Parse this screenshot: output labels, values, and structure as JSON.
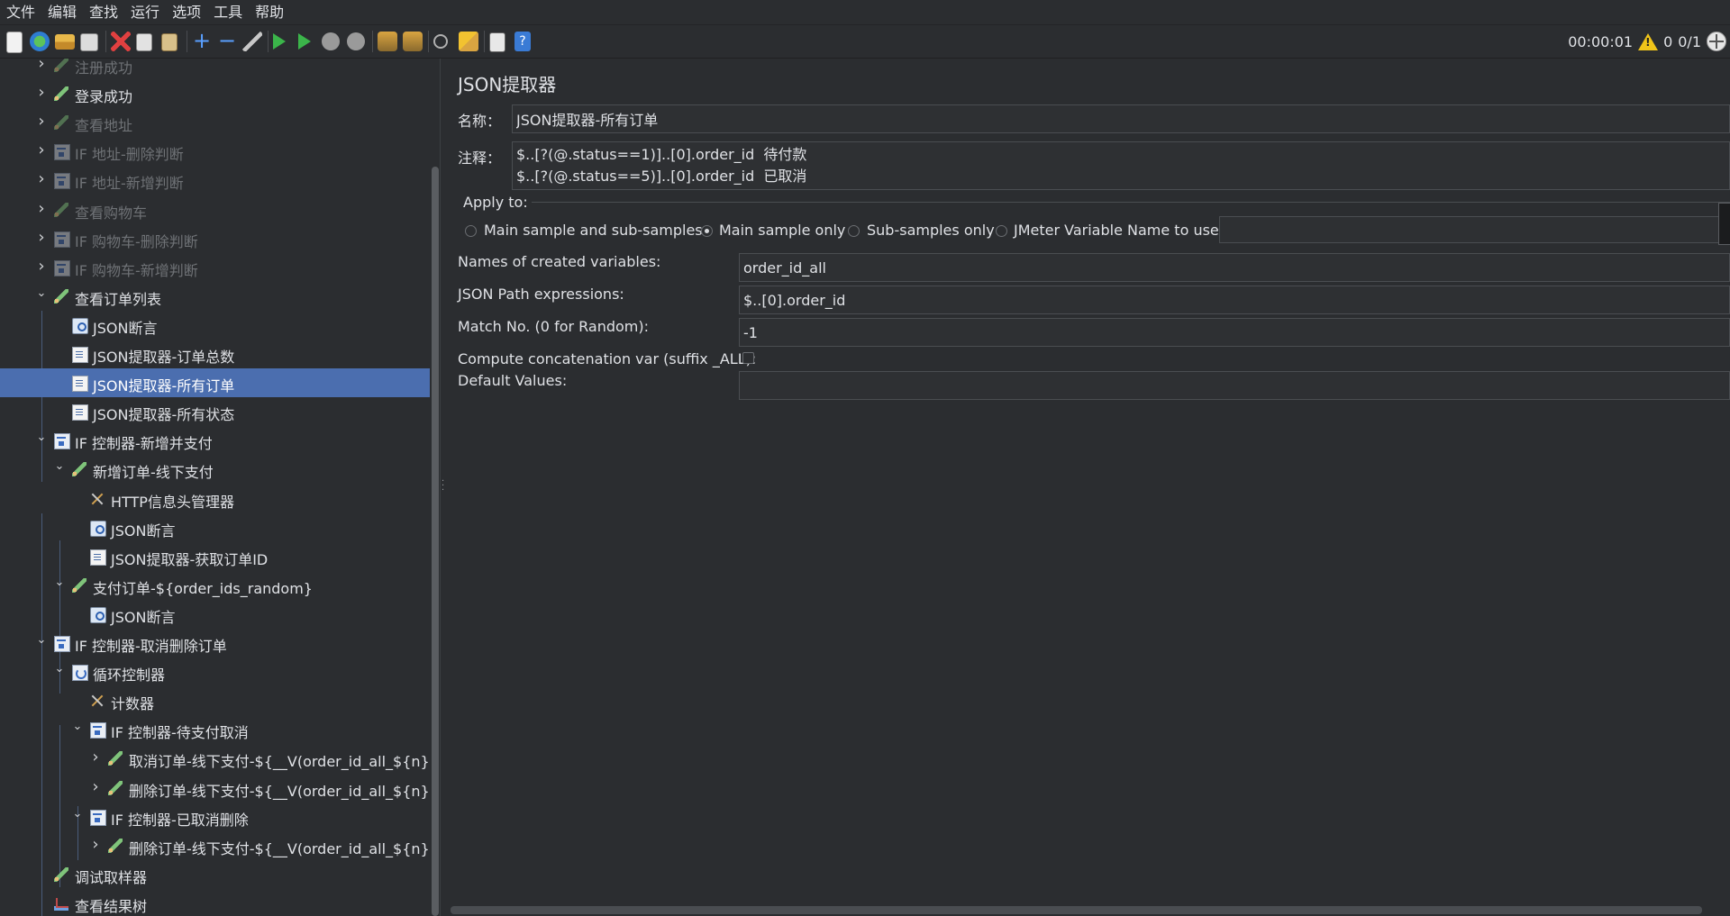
{
  "menubar": {
    "items": [
      "文件",
      "编辑",
      "查找",
      "运行",
      "选项",
      "工具",
      "帮助"
    ]
  },
  "toolbar": {
    "icons": [
      "new-icon",
      "templates-icon",
      "open-icon",
      "save-icon",
      "cut-icon",
      "copy-icon",
      "paste-icon",
      "expand-icon",
      "collapse-icon",
      "toggle-icon",
      "start-icon",
      "start-no-pause-icon",
      "stop-icon",
      "shutdown-icon",
      "clear-icon",
      "clear-all-icon",
      "search-icon",
      "reset-search-icon",
      "function-helper-icon",
      "help-icon"
    ],
    "elapsed_time": "00:00:01",
    "warning_count": "0",
    "thread_ratio": "0/1"
  },
  "tree": {
    "nodes": [
      {
        "label": "注册成功",
        "icon": "pencil-icon",
        "disabled": true
      },
      {
        "label": "登录成功",
        "icon": "pencil-icon",
        "disabled": false
      },
      {
        "label": "查看地址",
        "icon": "pencil-icon",
        "disabled": true
      },
      {
        "label": "IF 地址-删除判断",
        "icon": "if-controller-icon",
        "disabled": true
      },
      {
        "label": "IF 地址-新增判断",
        "icon": "if-controller-icon",
        "disabled": true
      },
      {
        "label": "查看购物车",
        "icon": "pencil-icon",
        "disabled": true
      },
      {
        "label": "IF 购物车-删除判断",
        "icon": "if-controller-icon",
        "disabled": true
      },
      {
        "label": "IF 购物车-新增判断",
        "icon": "if-controller-icon",
        "disabled": true
      },
      {
        "label": "查看订单列表",
        "icon": "pencil-icon",
        "disabled": false
      },
      {
        "label": "JSON断言",
        "icon": "assertion-icon",
        "disabled": false
      },
      {
        "label": "JSON提取器-订单总数",
        "icon": "extractor-icon",
        "disabled": false
      },
      {
        "label": "JSON提取器-所有订单",
        "icon": "extractor-icon",
        "disabled": false,
        "selected": true
      },
      {
        "label": "JSON提取器-所有状态",
        "icon": "extractor-icon",
        "disabled": false
      },
      {
        "label": "IF 控制器-新增并支付",
        "icon": "if-controller-icon",
        "disabled": false
      },
      {
        "label": "新增订单-线下支付",
        "icon": "pencil-icon",
        "disabled": false
      },
      {
        "label": "HTTP信息头管理器",
        "icon": "tools-icon",
        "disabled": false
      },
      {
        "label": "JSON断言",
        "icon": "assertion-icon",
        "disabled": false
      },
      {
        "label": "JSON提取器-获取订单ID",
        "icon": "extractor-icon",
        "disabled": false
      },
      {
        "label": "支付订单-${order_ids_random}",
        "icon": "pencil-icon",
        "disabled": false
      },
      {
        "label": "JSON断言",
        "icon": "assertion-icon",
        "disabled": false
      },
      {
        "label": "IF 控制器-取消删除订单",
        "icon": "if-controller-icon",
        "disabled": false
      },
      {
        "label": "循环控制器",
        "icon": "loop-controller-icon",
        "disabled": false
      },
      {
        "label": "计数器",
        "icon": "tools-icon",
        "disabled": false
      },
      {
        "label": "IF 控制器-待支付取消",
        "icon": "if-controller-icon",
        "disabled": false
      },
      {
        "label": "取消订单-线下支付-${__V(order_id_all_${n})}",
        "icon": "pencil-icon",
        "disabled": false
      },
      {
        "label": "删除订单-线下支付-${__V(order_id_all_${n})}",
        "icon": "pencil-icon",
        "disabled": false
      },
      {
        "label": "IF 控制器-已取消删除",
        "icon": "if-controller-icon",
        "disabled": false
      },
      {
        "label": "删除订单-线下支付-${__V(order_id_all_${n})}",
        "icon": "pencil-icon",
        "disabled": false
      },
      {
        "label": "调试取样器",
        "icon": "pencil-icon",
        "disabled": false
      },
      {
        "label": "查看结果树",
        "icon": "result-tree-icon",
        "disabled": false
      }
    ]
  },
  "editor": {
    "title": "JSON提取器",
    "name_label": "名称：",
    "name_value": "JSON提取器-所有订单",
    "comment_label": "注释：",
    "comment_value": "$..[?(@.status==1)]..[0].order_id  待付款\n$..[?(@.status==5)]..[0].order_id  已取消",
    "apply_to_label": "Apply to:",
    "apply_options": [
      {
        "label": "Main sample and sub-samples",
        "checked": false
      },
      {
        "label": "Main sample only",
        "checked": true
      },
      {
        "label": "Sub-samples only",
        "checked": false
      },
      {
        "label": "JMeter Variable Name to use",
        "checked": false
      }
    ],
    "variable_name_value": "",
    "names_label": "Names of created variables:",
    "names_value": "order_id_all",
    "json_path_label": "JSON Path expressions:",
    "json_path_value": "$..[0].order_id",
    "match_no_label": "Match No. (0 for Random):",
    "match_no_value": "-1",
    "concat_label": "Compute concatenation var (suffix _ALL):",
    "concat_checked": false,
    "default_label": "Default Values:",
    "default_value": ""
  }
}
